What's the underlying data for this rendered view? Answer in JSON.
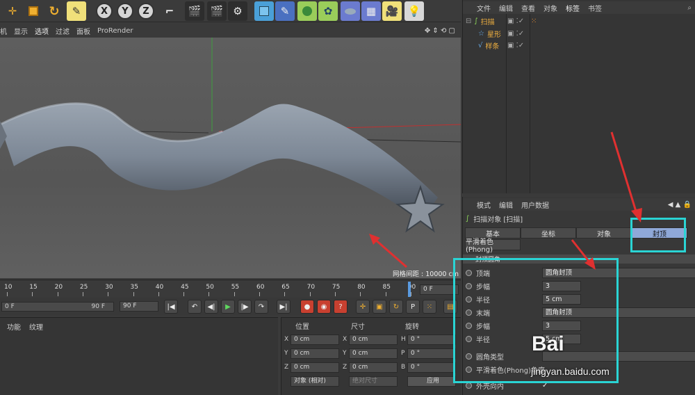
{
  "toolbar": {
    "axes": [
      "X",
      "Y",
      "Z"
    ]
  },
  "viewport_menu": [
    "机",
    "显示",
    "选项",
    "过滤",
    "面板",
    "ProRender"
  ],
  "viewport": {
    "grid_label": "网格间距 : 10000 cm"
  },
  "object_manager": {
    "menu": [
      "文件",
      "编辑",
      "查看",
      "对象",
      "标签",
      "书签"
    ],
    "objects": [
      {
        "name": "扫描",
        "color": "#f0b040"
      },
      {
        "name": "星形",
        "color": "#f0b040"
      },
      {
        "name": "样条",
        "color": "#f0b040"
      }
    ]
  },
  "attributes": {
    "menu": [
      "模式",
      "编辑",
      "用户数据"
    ],
    "object_title": "扫描对象 [扫描]",
    "tabs": [
      "基本",
      "坐标",
      "对象",
      "封顶"
    ],
    "active_tab": "封顶",
    "subtab": "平滑着色(Phong)",
    "section": "封顶圆角",
    "props": [
      {
        "label": "顶端",
        "value": "圆角封顶"
      },
      {
        "label": "步幅",
        "value": "3"
      },
      {
        "label": "半径",
        "value": "5 cm"
      },
      {
        "label": "末端",
        "value": "圆角封顶"
      },
      {
        "label": "步幅",
        "value": "3"
      },
      {
        "label": "半径",
        "value": "5 cm"
      },
      {
        "label": "圆角类型",
        "value": ""
      },
      {
        "label": "平滑着色(Phong)角度",
        "value": ""
      },
      {
        "label": "外壳向内",
        "value": "✓"
      }
    ]
  },
  "timeline": {
    "ticks": [
      "10",
      "15",
      "20",
      "25",
      "30",
      "35",
      "40",
      "45",
      "50",
      "55",
      "60",
      "65",
      "70",
      "75",
      "80",
      "85",
      "90"
    ],
    "frame_field": "0 F",
    "start": "0 F",
    "end": "90 F",
    "end_field": "90 F"
  },
  "material_panel": {
    "menu": [
      "功能",
      "纹理"
    ]
  },
  "coord_panel": {
    "headers": [
      "位置",
      "尺寸",
      "旋转"
    ],
    "rows": [
      {
        "axis": "X",
        "pos": "0 cm",
        "size_axis": "X",
        "size": "0 cm",
        "rot_axis": "H",
        "rot": "0 °"
      },
      {
        "axis": "Y",
        "pos": "0 cm",
        "size_axis": "Y",
        "size": "0 cm",
        "rot_axis": "P",
        "rot": "0 °"
      },
      {
        "axis": "Z",
        "pos": "0 cm",
        "size_axis": "Z",
        "size": "0 cm",
        "rot_axis": "B",
        "rot": "0 °"
      }
    ],
    "mode": "对象 (相对)",
    "size_mode": "绝对尺寸",
    "apply": "应用"
  },
  "watermark": {
    "logo": "Bai",
    "site": "jingyan.baidu.com"
  },
  "colors": {
    "annotation": "#2ad4d4",
    "arrow": "#e03030",
    "active_tab": "#8fa8d8"
  }
}
